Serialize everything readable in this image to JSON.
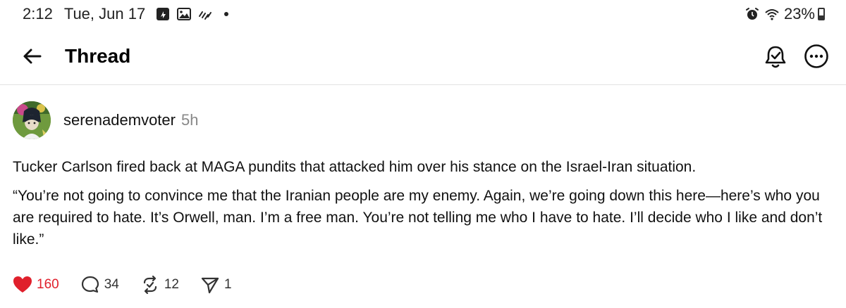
{
  "status_bar": {
    "time": "2:12",
    "date": "Tue, Jun 17",
    "battery": "23%"
  },
  "header": {
    "title": "Thread"
  },
  "post": {
    "username": "serenademvoter",
    "time_ago": "5h",
    "paragraphs": [
      "Tucker Carlson fired back at MAGA pundits that attacked him over his stance on the Israel-Iran situation.",
      "“You’re not going to convince me that the Iranian people are my enemy. Again, we’re going down this here—here’s who you are required to hate. It’s Orwell, man. I’m a free man. You’re not telling me who I have to hate. I’ll decide who I like and don’t like.”"
    ],
    "actions": {
      "likes": "160",
      "replies": "34",
      "reposts": "12",
      "shares": "1"
    }
  },
  "colors": {
    "like_red": "#e0202c",
    "divider": "#e2e2e2"
  },
  "icons": [
    "arrow-left-icon",
    "bell-check-icon",
    "more-icon",
    "heart-icon",
    "comment-icon",
    "repost-icon",
    "send-icon",
    "alarm-icon",
    "wifi-icon"
  ]
}
